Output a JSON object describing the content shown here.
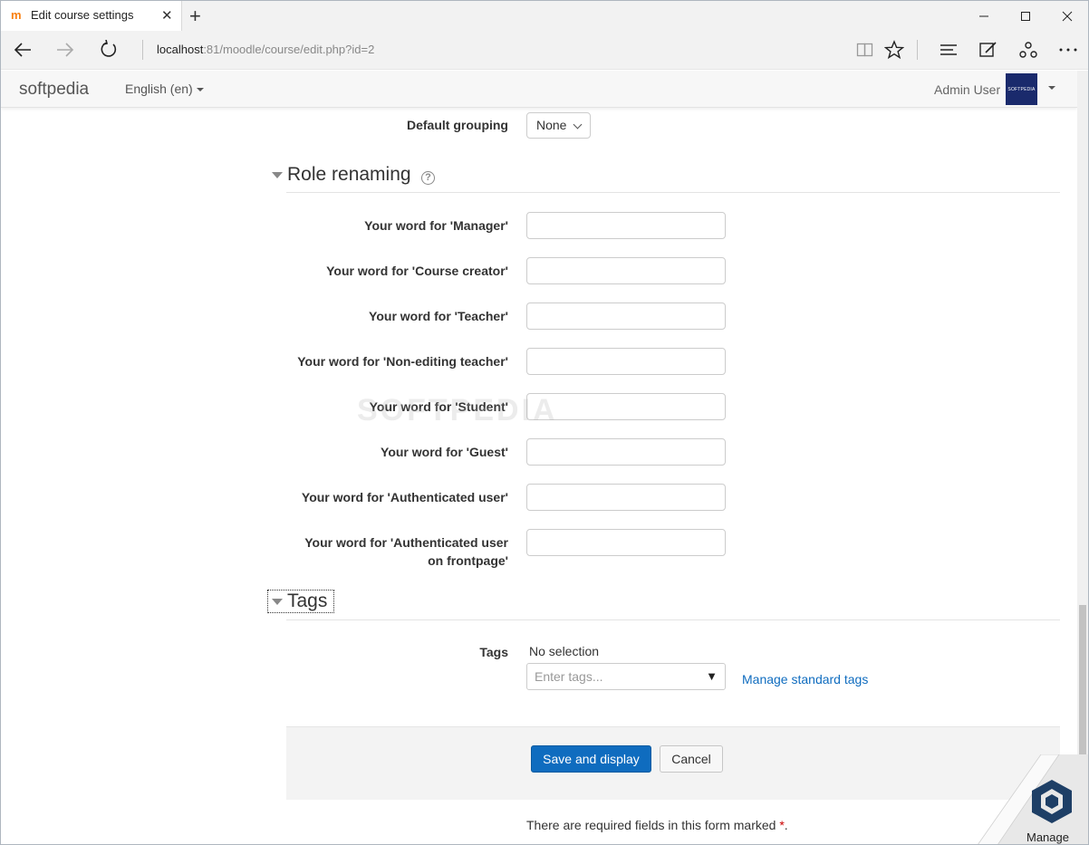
{
  "browser": {
    "tab_title": "Edit course settings",
    "favicon": "m",
    "url_host": "localhost",
    "url_rest": ":81/moodle/course/edit.php?id=2"
  },
  "header": {
    "brand": "softpedia",
    "language": "English (en)",
    "user": "Admin User",
    "avatar_text": "SOFTPEDIA"
  },
  "form": {
    "default_grouping_label": "Default grouping",
    "default_grouping_value": "None",
    "role_section_title": "Role renaming",
    "help_icon": "?",
    "roles": [
      {
        "label": "Your word for 'Manager'",
        "value": ""
      },
      {
        "label": "Your word for 'Course creator'",
        "value": ""
      },
      {
        "label": "Your word for 'Teacher'",
        "value": ""
      },
      {
        "label": "Your word for 'Non-editing teacher'",
        "value": ""
      },
      {
        "label": "Your word for 'Student'",
        "value": ""
      },
      {
        "label": "Your word for 'Guest'",
        "value": ""
      },
      {
        "label": "Your word for 'Authenticated user'",
        "value": ""
      },
      {
        "label_line1": "Your word for 'Authenticated user",
        "label_line2": "on frontpage'",
        "value": ""
      }
    ],
    "tags_section_title": "Tags",
    "tags_label": "Tags",
    "tags_selection": "No selection",
    "tags_placeholder": "Enter tags...",
    "tags_dropdown_glyph": "▼",
    "manage_tags_link": "Manage standard tags",
    "save_button": "Save and display",
    "cancel_button": "Cancel",
    "required_note": "There are required fields in this form marked",
    "required_star": "*",
    "required_end": "."
  },
  "watermark": "SOFTPEDIA",
  "manage_badge": "Manage",
  "colors": {
    "primary": "#0f6cbf",
    "link": "#0f6cbf",
    "required": "#cc0000",
    "avatar_bg": "#1a2a6c"
  }
}
